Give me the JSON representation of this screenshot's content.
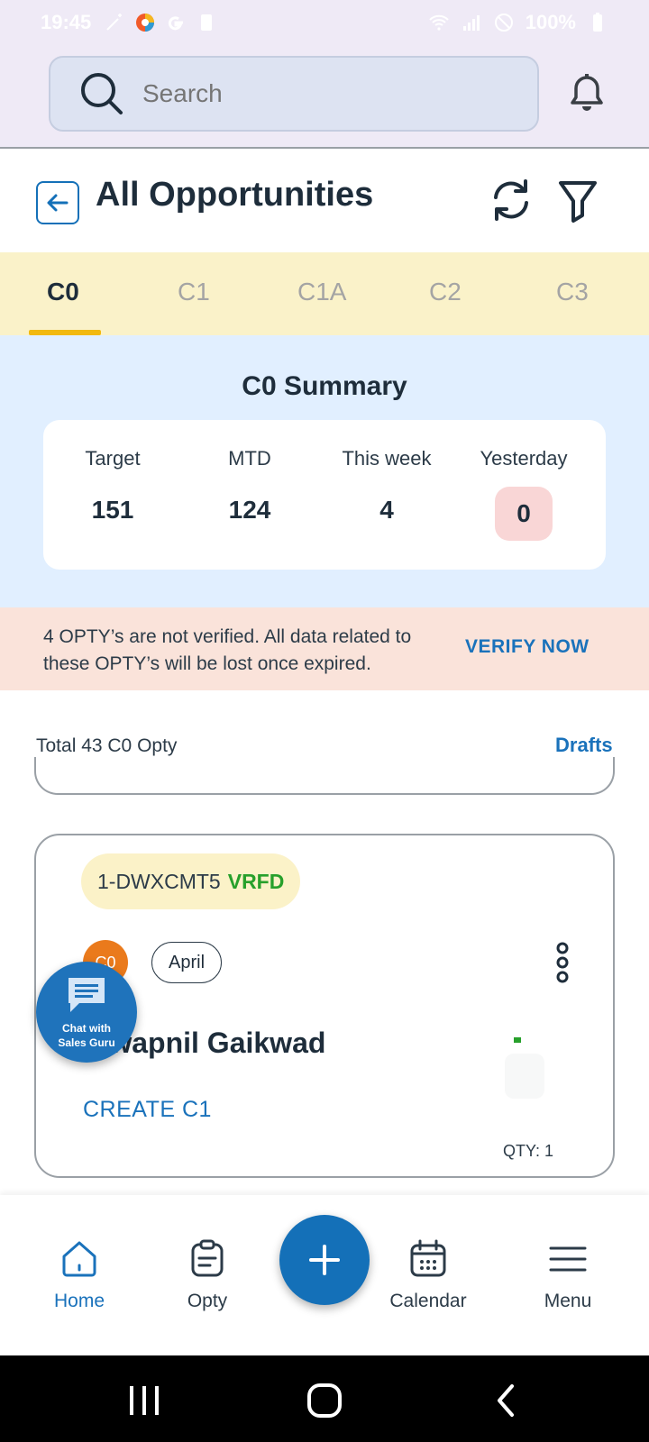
{
  "status_bar": {
    "time": "19:45",
    "battery": "100%"
  },
  "search": {
    "placeholder": "Search"
  },
  "header": {
    "title": "All Opportunities"
  },
  "tabs": [
    {
      "label": "C0",
      "active": true
    },
    {
      "label": "C1",
      "active": false
    },
    {
      "label": "C1A",
      "active": false
    },
    {
      "label": "C2",
      "active": false
    },
    {
      "label": "C3",
      "active": false
    }
  ],
  "summary": {
    "title": "C0 Summary",
    "metrics": [
      {
        "label": "Target",
        "value": "151"
      },
      {
        "label": "MTD",
        "value": "124"
      },
      {
        "label": "This week",
        "value": "4"
      },
      {
        "label": "Yesterday",
        "value": "0"
      }
    ]
  },
  "alert": {
    "message": "4 OPTY’s are not verified. All data related to these OPTY’s will be lost once expired.",
    "action": "VERIFY NOW"
  },
  "list": {
    "total_text": "Total 43 C0 Opty",
    "drafts_label": "Drafts"
  },
  "card": {
    "opty_id": "1-DWXCMT5",
    "verified_label": "VRFD",
    "stage": "C0",
    "month": "April",
    "customer_name": "Swapnil Gaikwad",
    "action": "CREATE C1",
    "qty": "QTY: 1"
  },
  "chat_fab": {
    "line1": "Chat with",
    "line2": "Sales Guru"
  },
  "bottom_nav": {
    "home": "Home",
    "opty": "Opty",
    "calendar": "Calendar",
    "menu": "Menu"
  },
  "colors": {
    "brand_blue": "#1470b8",
    "tab_bg": "#faf2c9",
    "summary_bg": "#e1efff",
    "alert_bg": "#fae3da",
    "verified_green": "#27a02b"
  }
}
